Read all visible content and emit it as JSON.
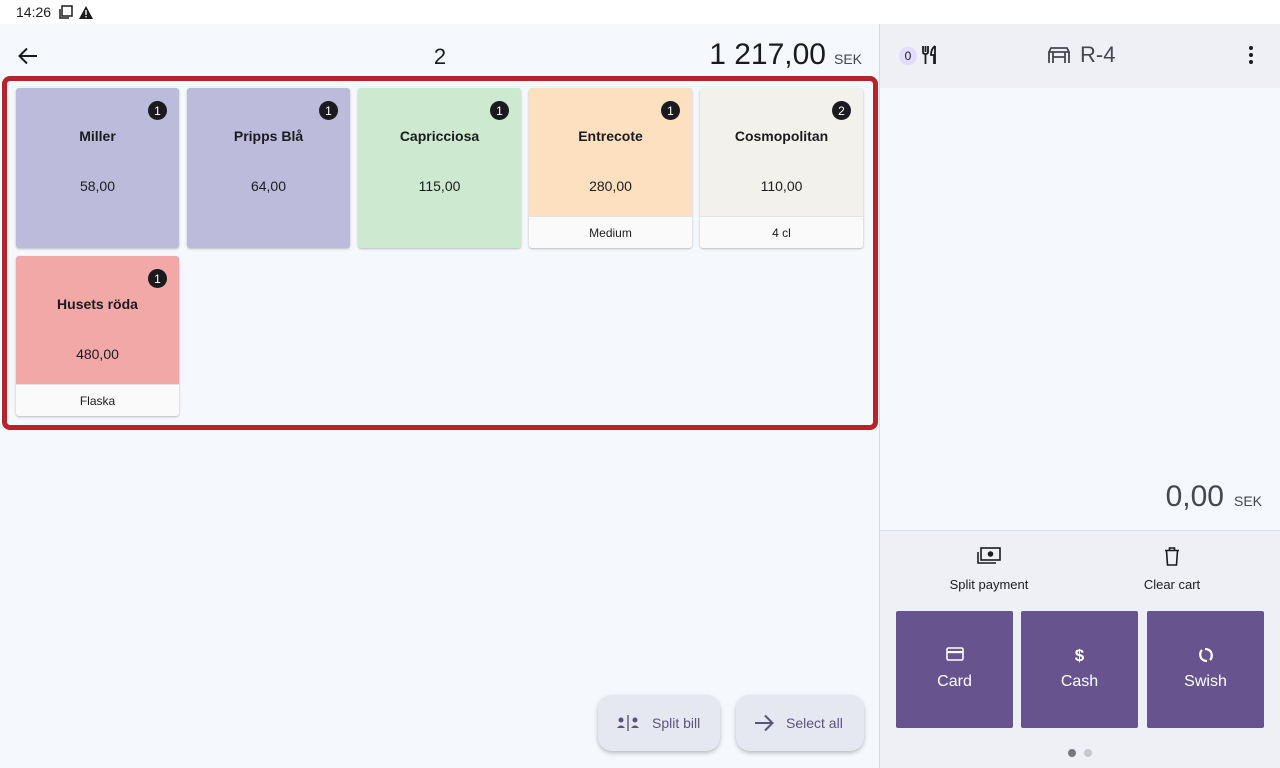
{
  "status_bar": {
    "time": "14:26"
  },
  "order": {
    "number": "2",
    "total": "1 217,00",
    "currency": "SEK"
  },
  "products": [
    {
      "name": "Miller",
      "price": "58,00",
      "qty": "1",
      "modifier": "",
      "color": "#bcbbdb"
    },
    {
      "name": "Pripps Blå",
      "price": "64,00",
      "qty": "1",
      "modifier": "",
      "color": "#bcbbdb"
    },
    {
      "name": "Capricciosa",
      "price": "115,00",
      "qty": "1",
      "modifier": "",
      "color": "#cde9cf"
    },
    {
      "name": "Entrecote",
      "price": "280,00",
      "qty": "1",
      "modifier": "Medium",
      "color": "#fde0c0"
    },
    {
      "name": "Cosmopolitan",
      "price": "110,00",
      "qty": "2",
      "modifier": "4 cl",
      "color": "#f3f1ec"
    },
    {
      "name": "Husets röda",
      "price": "480,00",
      "qty": "1",
      "modifier": "Flaska",
      "color": "#f3a8a8"
    }
  ],
  "left_actions": {
    "split_bill": "Split bill",
    "select_all": "Select all"
  },
  "cart": {
    "item_count": "0",
    "table": "R-4",
    "total": "0,00",
    "currency": "SEK",
    "split_payment": "Split payment",
    "clear_cart": "Clear cart"
  },
  "payment_methods": [
    {
      "label": "Card",
      "icon": "credit-card-icon"
    },
    {
      "label": "Cash",
      "icon": "dollar-icon"
    },
    {
      "label": "Swish",
      "icon": "swish-icon"
    }
  ],
  "colors": {
    "accent": "#67548e",
    "highlight_border": "#b7232a"
  }
}
